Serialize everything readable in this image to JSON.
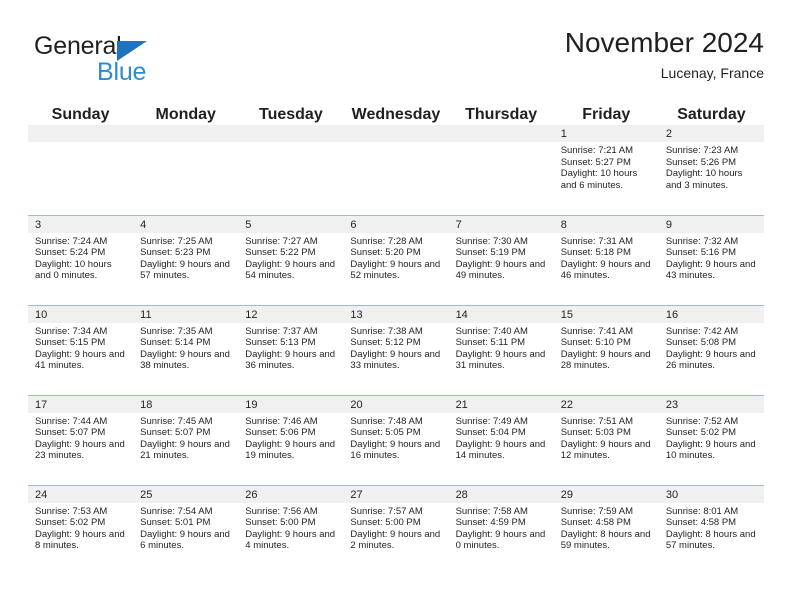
{
  "logo": {
    "primary_text": "General",
    "secondary_text": "Blue",
    "primary_color": "#231f20",
    "secondary_color": "#2e8bd0",
    "triangle_color": "#1e73be"
  },
  "header": {
    "title": "November 2024",
    "subtitle": "Lucenay, France"
  },
  "theme": {
    "header_bg": "#3a7cc0",
    "header_text": "#ffffff",
    "daynum_bg": "#f0f0f0",
    "row_border": "#9fb8d4",
    "body_text": "#231f20"
  },
  "weekdays": [
    "Sunday",
    "Monday",
    "Tuesday",
    "Wednesday",
    "Thursday",
    "Friday",
    "Saturday"
  ],
  "weeks": [
    [
      {
        "day": "",
        "empty": true
      },
      {
        "day": "",
        "empty": true
      },
      {
        "day": "",
        "empty": true
      },
      {
        "day": "",
        "empty": true
      },
      {
        "day": "",
        "empty": true
      },
      {
        "day": "1",
        "sunrise": "Sunrise: 7:21 AM",
        "sunset": "Sunset: 5:27 PM",
        "daylight": "Daylight: 10 hours and 6 minutes."
      },
      {
        "day": "2",
        "sunrise": "Sunrise: 7:23 AM",
        "sunset": "Sunset: 5:26 PM",
        "daylight": "Daylight: 10 hours and 3 minutes."
      }
    ],
    [
      {
        "day": "3",
        "sunrise": "Sunrise: 7:24 AM",
        "sunset": "Sunset: 5:24 PM",
        "daylight": "Daylight: 10 hours and 0 minutes."
      },
      {
        "day": "4",
        "sunrise": "Sunrise: 7:25 AM",
        "sunset": "Sunset: 5:23 PM",
        "daylight": "Daylight: 9 hours and 57 minutes."
      },
      {
        "day": "5",
        "sunrise": "Sunrise: 7:27 AM",
        "sunset": "Sunset: 5:22 PM",
        "daylight": "Daylight: 9 hours and 54 minutes."
      },
      {
        "day": "6",
        "sunrise": "Sunrise: 7:28 AM",
        "sunset": "Sunset: 5:20 PM",
        "daylight": "Daylight: 9 hours and 52 minutes."
      },
      {
        "day": "7",
        "sunrise": "Sunrise: 7:30 AM",
        "sunset": "Sunset: 5:19 PM",
        "daylight": "Daylight: 9 hours and 49 minutes."
      },
      {
        "day": "8",
        "sunrise": "Sunrise: 7:31 AM",
        "sunset": "Sunset: 5:18 PM",
        "daylight": "Daylight: 9 hours and 46 minutes."
      },
      {
        "day": "9",
        "sunrise": "Sunrise: 7:32 AM",
        "sunset": "Sunset: 5:16 PM",
        "daylight": "Daylight: 9 hours and 43 minutes."
      }
    ],
    [
      {
        "day": "10",
        "sunrise": "Sunrise: 7:34 AM",
        "sunset": "Sunset: 5:15 PM",
        "daylight": "Daylight: 9 hours and 41 minutes."
      },
      {
        "day": "11",
        "sunrise": "Sunrise: 7:35 AM",
        "sunset": "Sunset: 5:14 PM",
        "daylight": "Daylight: 9 hours and 38 minutes."
      },
      {
        "day": "12",
        "sunrise": "Sunrise: 7:37 AM",
        "sunset": "Sunset: 5:13 PM",
        "daylight": "Daylight: 9 hours and 36 minutes."
      },
      {
        "day": "13",
        "sunrise": "Sunrise: 7:38 AM",
        "sunset": "Sunset: 5:12 PM",
        "daylight": "Daylight: 9 hours and 33 minutes."
      },
      {
        "day": "14",
        "sunrise": "Sunrise: 7:40 AM",
        "sunset": "Sunset: 5:11 PM",
        "daylight": "Daylight: 9 hours and 31 minutes."
      },
      {
        "day": "15",
        "sunrise": "Sunrise: 7:41 AM",
        "sunset": "Sunset: 5:10 PM",
        "daylight": "Daylight: 9 hours and 28 minutes."
      },
      {
        "day": "16",
        "sunrise": "Sunrise: 7:42 AM",
        "sunset": "Sunset: 5:08 PM",
        "daylight": "Daylight: 9 hours and 26 minutes."
      }
    ],
    [
      {
        "day": "17",
        "sunrise": "Sunrise: 7:44 AM",
        "sunset": "Sunset: 5:07 PM",
        "daylight": "Daylight: 9 hours and 23 minutes."
      },
      {
        "day": "18",
        "sunrise": "Sunrise: 7:45 AM",
        "sunset": "Sunset: 5:07 PM",
        "daylight": "Daylight: 9 hours and 21 minutes."
      },
      {
        "day": "19",
        "sunrise": "Sunrise: 7:46 AM",
        "sunset": "Sunset: 5:06 PM",
        "daylight": "Daylight: 9 hours and 19 minutes."
      },
      {
        "day": "20",
        "sunrise": "Sunrise: 7:48 AM",
        "sunset": "Sunset: 5:05 PM",
        "daylight": "Daylight: 9 hours and 16 minutes."
      },
      {
        "day": "21",
        "sunrise": "Sunrise: 7:49 AM",
        "sunset": "Sunset: 5:04 PM",
        "daylight": "Daylight: 9 hours and 14 minutes."
      },
      {
        "day": "22",
        "sunrise": "Sunrise: 7:51 AM",
        "sunset": "Sunset: 5:03 PM",
        "daylight": "Daylight: 9 hours and 12 minutes."
      },
      {
        "day": "23",
        "sunrise": "Sunrise: 7:52 AM",
        "sunset": "Sunset: 5:02 PM",
        "daylight": "Daylight: 9 hours and 10 minutes."
      }
    ],
    [
      {
        "day": "24",
        "sunrise": "Sunrise: 7:53 AM",
        "sunset": "Sunset: 5:02 PM",
        "daylight": "Daylight: 9 hours and 8 minutes."
      },
      {
        "day": "25",
        "sunrise": "Sunrise: 7:54 AM",
        "sunset": "Sunset: 5:01 PM",
        "daylight": "Daylight: 9 hours and 6 minutes."
      },
      {
        "day": "26",
        "sunrise": "Sunrise: 7:56 AM",
        "sunset": "Sunset: 5:00 PM",
        "daylight": "Daylight: 9 hours and 4 minutes."
      },
      {
        "day": "27",
        "sunrise": "Sunrise: 7:57 AM",
        "sunset": "Sunset: 5:00 PM",
        "daylight": "Daylight: 9 hours and 2 minutes."
      },
      {
        "day": "28",
        "sunrise": "Sunrise: 7:58 AM",
        "sunset": "Sunset: 4:59 PM",
        "daylight": "Daylight: 9 hours and 0 minutes."
      },
      {
        "day": "29",
        "sunrise": "Sunrise: 7:59 AM",
        "sunset": "Sunset: 4:58 PM",
        "daylight": "Daylight: 8 hours and 59 minutes."
      },
      {
        "day": "30",
        "sunrise": "Sunrise: 8:01 AM",
        "sunset": "Sunset: 4:58 PM",
        "daylight": "Daylight: 8 hours and 57 minutes."
      }
    ]
  ]
}
